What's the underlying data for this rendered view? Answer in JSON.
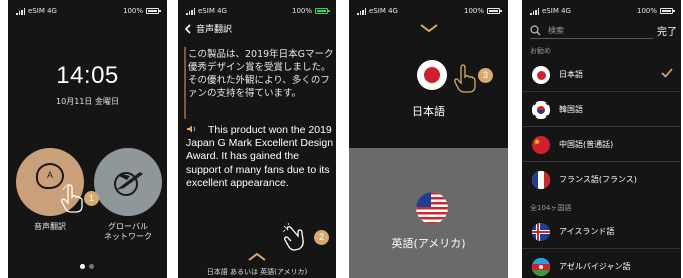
{
  "status": {
    "carrier": "eSIM 4G",
    "battery": "100%"
  },
  "screen1": {
    "time": "14:05",
    "date": "10月11日 金曜日",
    "voice_app_label": "音声翻訳",
    "global_app_label": "グローバル\nネットワーク",
    "bubble_letter": "A",
    "step_badge": "1"
  },
  "screen2": {
    "title": "音声翻訳",
    "jp_text": "この製品は、2019年日本Gマーク優秀デザイン賞を受賞しました。その優れた外観により、多くのファンの支持を得ています。",
    "en_text": "This product won the 2019 Japan G Mark Excellent Design Award. It has gained the support of many fans due to its excellent appearance.",
    "step_badge": "2",
    "footer": "日本語 あるいは 英語(アメリカ)"
  },
  "screen3": {
    "top_language": "日本語",
    "bottom_language": "英語(アメリカ)",
    "step_badge": "3"
  },
  "screen4": {
    "search_placeholder": "検索",
    "done_label": "完了",
    "recommended_label": "お勧め",
    "all_label": "全104ヶ国語",
    "recommended": [
      {
        "name": "日本語",
        "flag": "japan",
        "selected": true
      },
      {
        "name": "韓国語",
        "flag": "korea",
        "selected": false
      },
      {
        "name": "中国語(普通話)",
        "flag": "china",
        "selected": false
      },
      {
        "name": "フランス語(フランス)",
        "flag": "france",
        "selected": false
      }
    ],
    "all": [
      {
        "name": "アイスランド語",
        "flag": "iceland"
      },
      {
        "name": "アゼルバイジャン語",
        "flag": "azerbaijan"
      }
    ]
  },
  "colors": {
    "accent_gold": "#d7aa70",
    "check": "#e0b07a"
  }
}
